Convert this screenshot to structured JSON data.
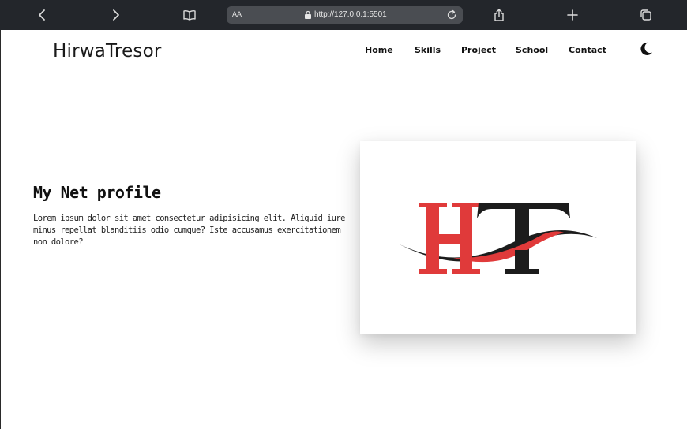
{
  "browser": {
    "text_size_label": "AA",
    "url": "http://127.0.0.1:5501"
  },
  "header": {
    "brand": "HirwaTresor",
    "nav": [
      "Home",
      "Skills",
      "Project",
      "School",
      "Contact"
    ]
  },
  "hero": {
    "title": "My Net profile",
    "text": "Lorem ipsum dolor sit amet consectetur adipisicing elit. Aliquid iure minus repellat blanditiis odio cumque? Iste accusamus exercitationem non dolore?"
  },
  "logo": {
    "letters": "HT",
    "colors": {
      "red": "#e03a3a",
      "dark": "#1c1c1c"
    }
  },
  "colors": {
    "toolbar_bg": "#23262b",
    "url_bar_bg": "#4a4d52",
    "page_bg": "#ffffff"
  }
}
